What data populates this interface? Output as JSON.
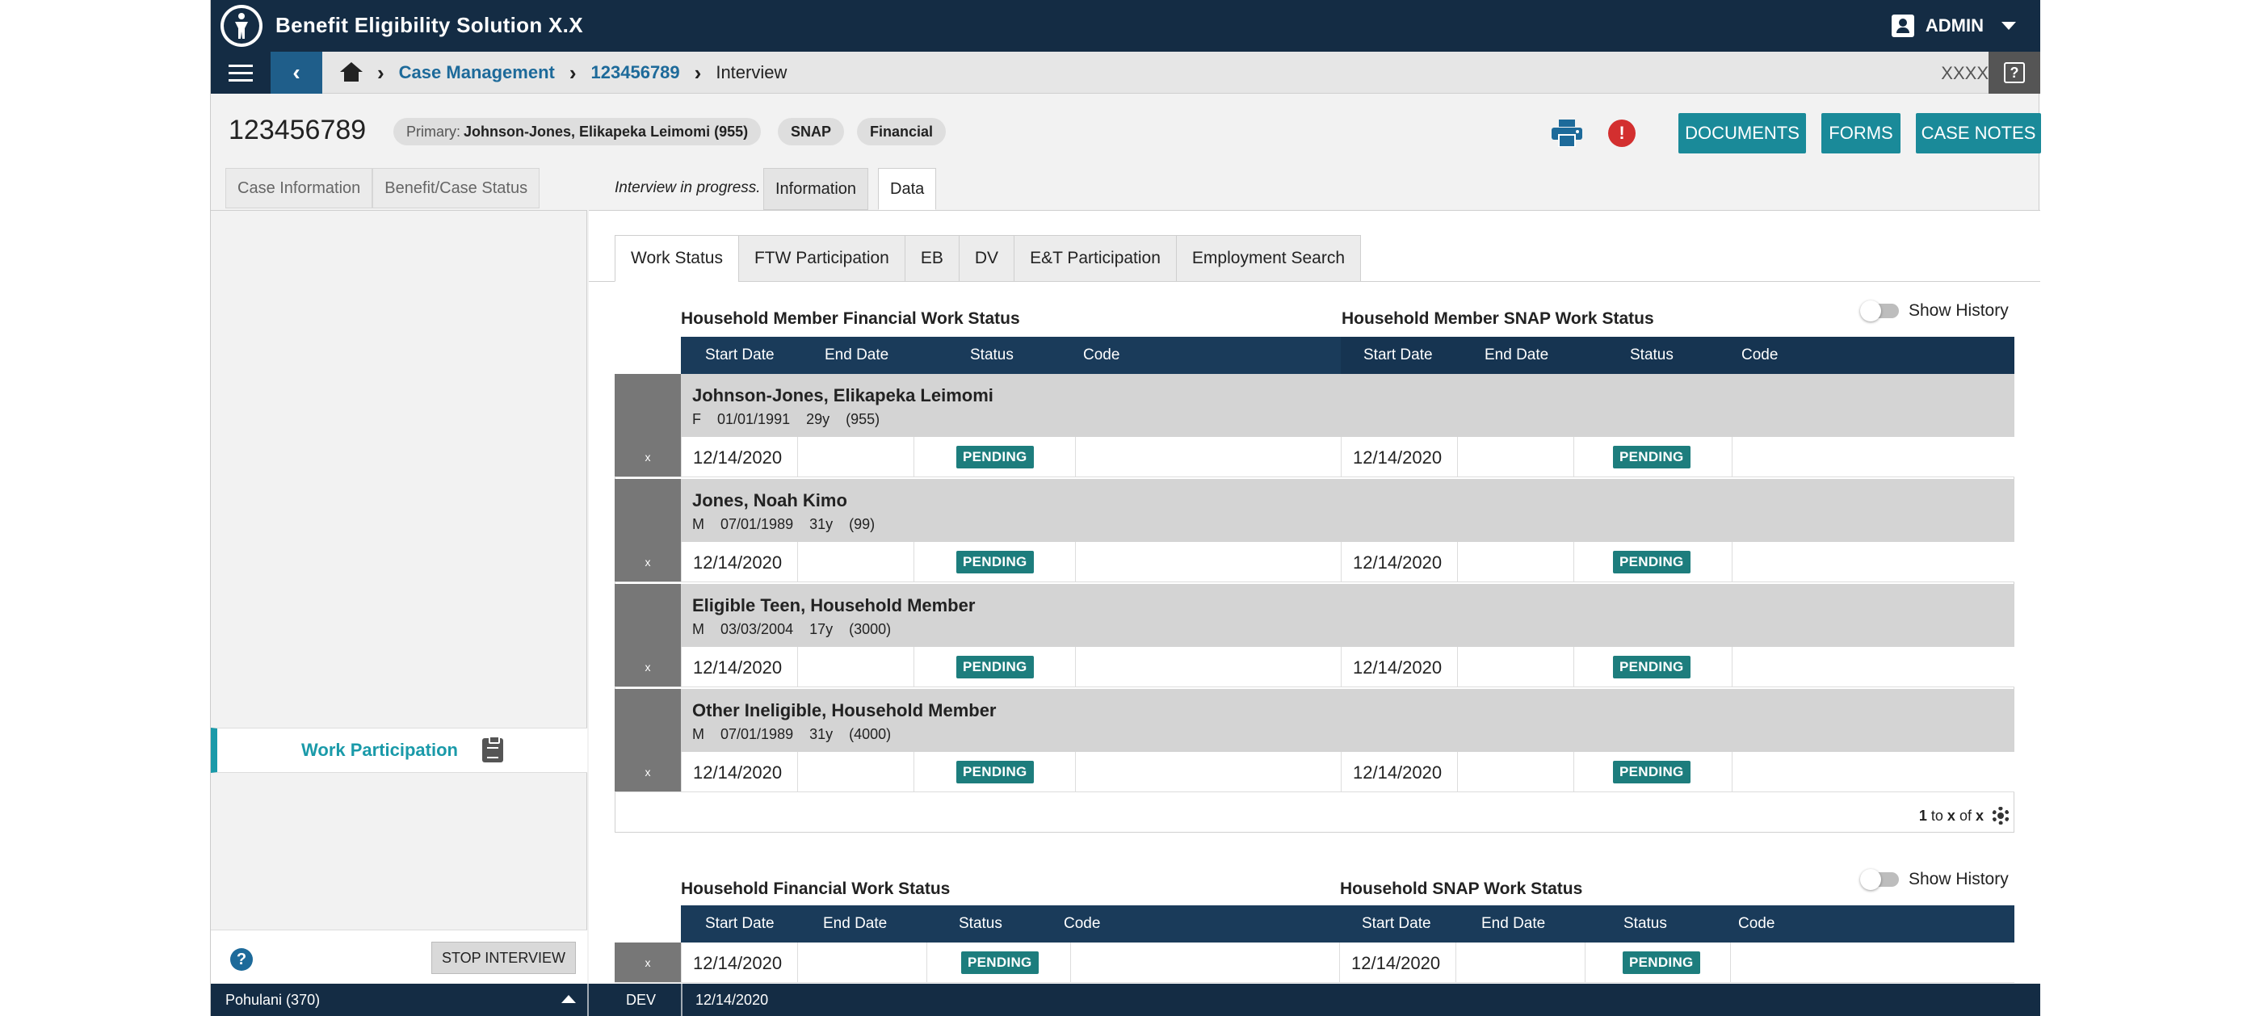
{
  "app": {
    "title": "Benefit Eligibility Solution X.X",
    "user": "ADMIN",
    "env_code": "XXXX",
    "help": "?"
  },
  "breadcrumb": {
    "items": [
      "Case Management",
      "123456789"
    ],
    "current": "Interview"
  },
  "case": {
    "id": "123456789",
    "primary_label": "Primary:",
    "primary_value": "Johnson-Jones, Elikapeka Leimomi (955)",
    "programs": [
      "SNAP",
      "Financial"
    ]
  },
  "actions": {
    "documents": "DOCUMENTS",
    "forms": "FORMS",
    "case_notes": "CASE NOTES",
    "alert": "!"
  },
  "left_tabs": [
    "Case Information",
    "Benefit/Case Status"
  ],
  "interview": {
    "status_text": "Interview in progress.",
    "tabs": [
      "Information",
      "Data"
    ]
  },
  "left_nav": {
    "work_participation": "Work Participation",
    "stop_interview": "STOP INTERVIEW",
    "help": "?"
  },
  "sub_tabs": [
    "Work Status",
    "FTW Participation",
    "EB",
    "DV",
    "E&T Participation",
    "Employment Search"
  ],
  "member_section": {
    "financial_title": "Household Member Financial Work Status",
    "snap_title": "Household Member SNAP Work Status",
    "show_history": "Show History",
    "columns": [
      "Start Date",
      "End Date",
      "Status",
      "Code"
    ],
    "members": [
      {
        "name": "Johnson-Jones, Elikapeka Leimomi",
        "gender": "F",
        "dob": "01/01/1991",
        "age": "29y",
        "id": "(955)",
        "fin_start": "12/14/2020",
        "fin_status": "PENDING",
        "snap_start": "12/14/2020",
        "snap_status": "PENDING",
        "remove": "x"
      },
      {
        "name": "Jones, Noah Kimo",
        "gender": "M",
        "dob": "07/01/1989",
        "age": "31y",
        "id": "(99)",
        "fin_start": "12/14/2020",
        "fin_status": "PENDING",
        "snap_start": "12/14/2020",
        "snap_status": "PENDING",
        "remove": "x"
      },
      {
        "name": "Eligible Teen, Household Member",
        "gender": "M",
        "dob": "03/03/2004",
        "age": "17y",
        "id": "(3000)",
        "fin_start": "12/14/2020",
        "fin_status": "PENDING",
        "snap_start": "12/14/2020",
        "snap_status": "PENDING",
        "remove": "x"
      },
      {
        "name": "Other Ineligible, Household Member",
        "gender": "M",
        "dob": "07/01/1989",
        "age": "31y",
        "id": "(4000)",
        "fin_start": "12/14/2020",
        "fin_status": "PENDING",
        "snap_start": "12/14/2020",
        "snap_status": "PENDING",
        "remove": "x"
      }
    ],
    "pager": {
      "from": "1",
      "to_label": "to",
      "to": "x",
      "of_label": "of",
      "total": "x"
    }
  },
  "household_section": {
    "financial_title": "Household Financial Work Status",
    "snap_title": "Household SNAP Work Status",
    "show_history": "Show History",
    "columns": [
      "Start Date",
      "End Date",
      "Status",
      "Code"
    ],
    "row": {
      "fin_start": "12/14/2020",
      "fin_status": "PENDING",
      "snap_start": "12/14/2020",
      "snap_status": "PENDING",
      "remove": "x"
    }
  },
  "status_bar": {
    "worker": "Pohulani (370)",
    "env": "DEV",
    "date": "12/14/2020"
  },
  "colors": {
    "navy": "#142c44",
    "teal": "#1a8a99",
    "link": "#1d6a9a",
    "badge": "#1d7d7d",
    "alert": "#d32f2f"
  }
}
